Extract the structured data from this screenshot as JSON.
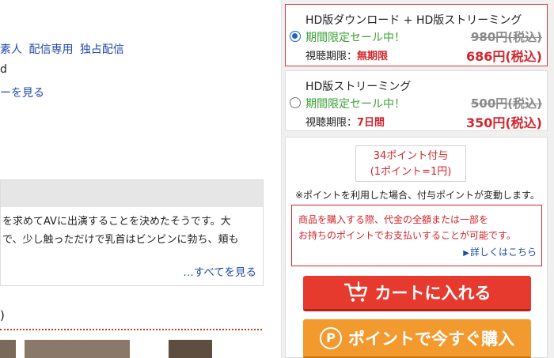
{
  "left": {
    "tags": [
      "素人",
      "配信専用",
      "独占配信"
    ],
    "frag_d": "d",
    "more_link": "ーを見る",
    "description": {
      "line1": "を求めてAVに出演することを決めたそうです。大",
      "line2": "で、少し触っただけで乳首はビンビンに勃ち、頬も",
      "see_all": "…すべてを見る"
    },
    "paren_text": ")"
  },
  "options": [
    {
      "title": "HD版ダウンロード + HD版ストリーミング",
      "sale_label": "期間限定セール中！",
      "old_price": "980円(税込)",
      "period_label": "視聴期限：",
      "period_value": "無期限",
      "new_price": "686円(税込)",
      "selected": true
    },
    {
      "title": "HD版ストリーミング",
      "sale_label": "期間限定セール中！",
      "old_price": "500円(税込)",
      "period_label": "視聴期限：",
      "period_value": "7日間",
      "new_price": "350円(税込)",
      "selected": false
    }
  ],
  "points": {
    "grant": "34ポイント付与",
    "rate": "(1ポイント=1円)",
    "note": "※ポイントを利用した場合、付与ポイントが変動します。",
    "notice_line1": "商品を購入する際、代金の全額または一部を",
    "notice_line2": "お持ちのポイントでお支払いすることが可能です。",
    "details_link": "詳しくはこちら"
  },
  "buttons": {
    "cart": "カートに入れる",
    "point_buy": "ポイントで今すぐ購入",
    "point_icon_letter": "P"
  },
  "icons": [
    "cart-icon",
    "point-icon",
    "radio-selected",
    "radio-unselected",
    "triangle-right-icon"
  ],
  "colors": {
    "link_blue": "#1f4aa8",
    "price_red": "#d1262d",
    "sale_green": "#3aa235",
    "cart_button": "#e63a2e",
    "point_button": "#f39a2f",
    "radio_blue": "#1b64c8"
  }
}
